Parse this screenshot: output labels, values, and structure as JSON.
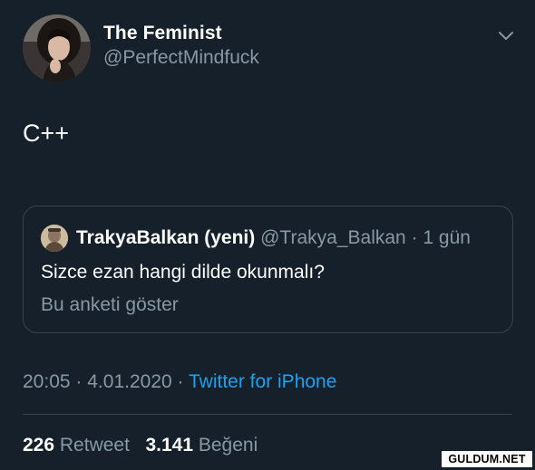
{
  "tweet": {
    "author_name": "The Feminist",
    "author_handle": "@PerfectMindfuck",
    "text": "C++",
    "avatar_icon": "profile-photo",
    "menu_icon": "chevron-down-icon"
  },
  "quoted_tweet": {
    "author_name": "TrakyaBalkan (yeni)",
    "author_handle": "@Trakya_Balkan",
    "separator": "·",
    "age": "1 gün",
    "text": "Sizce ezan hangi dilde okunmalı?",
    "poll_link": "Bu anketi göster"
  },
  "meta": {
    "time": "20:05",
    "separator": "·",
    "date": "4.01.2020",
    "source": "Twitter for iPhone"
  },
  "stats": {
    "retweets_count": "226",
    "retweets_label": "Retweet",
    "likes_count": "3.141",
    "likes_label": "Beğeni"
  },
  "watermark": "GULDUM.NET",
  "colors": {
    "background": "#15202b",
    "secondary_text": "#8899a6",
    "link": "#1da1f2",
    "border": "#38444d"
  }
}
